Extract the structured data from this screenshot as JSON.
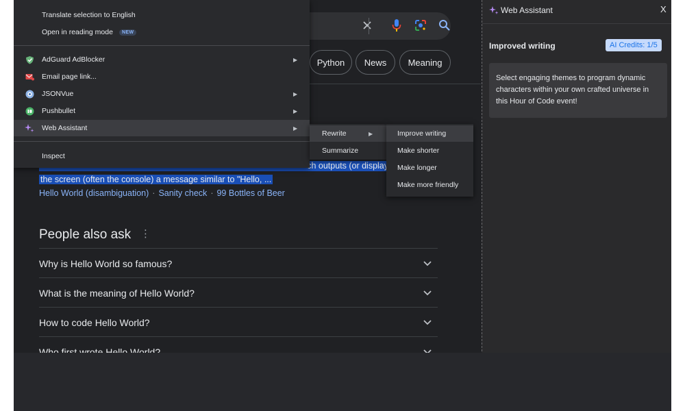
{
  "context_menu": {
    "items": [
      {
        "label": "Translate selection to English"
      },
      {
        "label": "Open in reading mode",
        "badge": "NEW"
      },
      {
        "label": "AdGuard AdBlocker",
        "icon": "adguard-shield-icon",
        "has_submenu": true
      },
      {
        "label": "Email page link...",
        "icon": "email-icon",
        "has_submenu": false
      },
      {
        "label": "JSONVue",
        "icon": "jsonvue-icon",
        "has_submenu": true
      },
      {
        "label": "Pushbullet",
        "icon": "pushbullet-icon",
        "has_submenu": true
      },
      {
        "label": "Web Assistant",
        "icon": "sparkle-icon",
        "has_submenu": true
      },
      {
        "label": "Inspect"
      }
    ]
  },
  "submenu_web_assistant": [
    {
      "label": "Rewrite",
      "has_submenu": true
    },
    {
      "label": "Summarize"
    }
  ],
  "submenu_rewrite": [
    {
      "label": "Improve writing"
    },
    {
      "label": "Make shorter"
    },
    {
      "label": "Make longer"
    },
    {
      "label": "Make more friendly"
    }
  ],
  "search": {
    "chips": [
      "Python",
      "News",
      "Meaning"
    ]
  },
  "snippet": {
    "line1_end": "ch outputs (or display",
    "line2": "the screen (often the console) a message similar to \"Hello, ..."
  },
  "related_links": [
    "Hello World (disambiguation)",
    "Sanity check",
    "99 Bottles of Beer"
  ],
  "people_also_ask": {
    "title": "People also ask",
    "questions": [
      "Why is Hello World so famous?",
      "What is the meaning of Hello World?",
      "How to code Hello World?",
      "Who first wrote Hello World?"
    ]
  },
  "side_panel": {
    "title": "Web Assistant",
    "close": "X",
    "subtitle": "Improved writing",
    "credits": "AI Credits: 1/5",
    "result": "Select engaging themes to program dynamic characters within your own crafted universe in this Hour of Code event!"
  },
  "colors": {
    "background": "#202124",
    "selection": "#1a4fb6",
    "link": "#8ab4f8",
    "credits_bg": "#c6dafc"
  }
}
